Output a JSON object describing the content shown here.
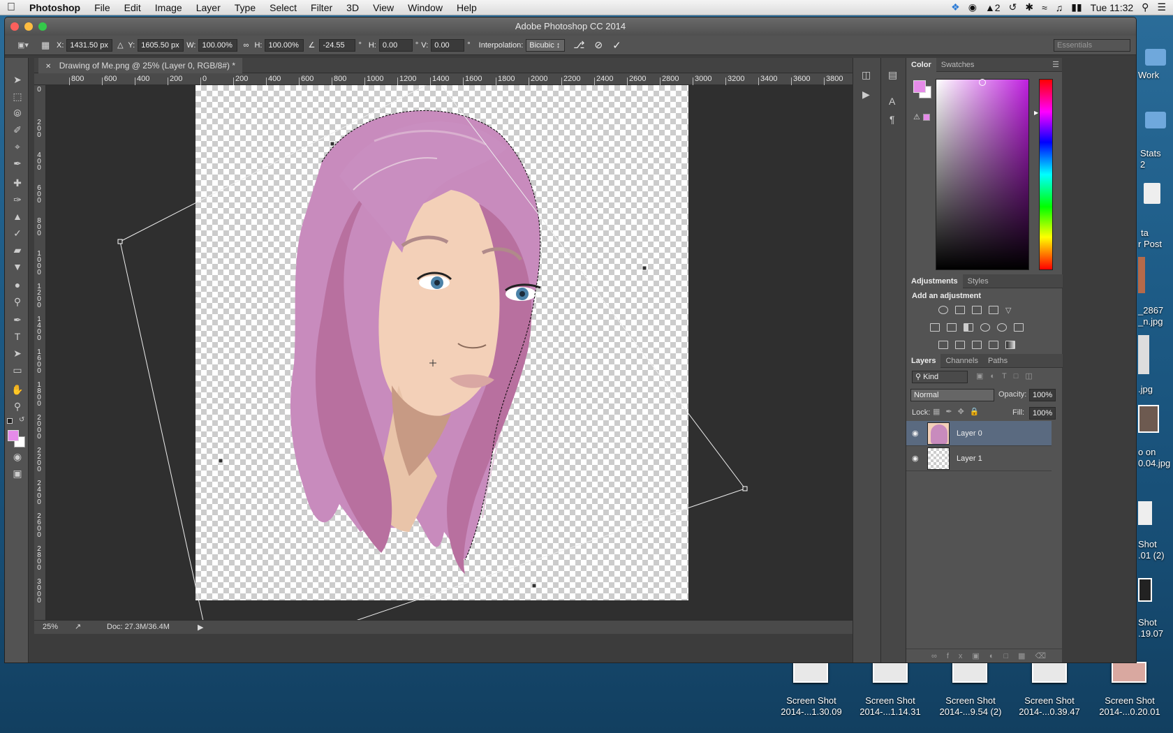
{
  "menubar": {
    "app": "Photoshop",
    "items": [
      "File",
      "Edit",
      "Image",
      "Layer",
      "Type",
      "Select",
      "Filter",
      "3D",
      "View",
      "Window",
      "Help"
    ],
    "status_indicator": "2",
    "clock": "Tue 11:32"
  },
  "window": {
    "title": "Adobe Photoshop CC 2014"
  },
  "options": {
    "x_label": "X:",
    "x": "1431.50 px",
    "y_label": "Y:",
    "y": "1605.50 px",
    "w_label": "W:",
    "w": "100.00%",
    "h_label": "H:",
    "h": "100.00%",
    "angle": "-24.55",
    "angle_unit": "°",
    "hskew_label": "H:",
    "hskew": "0.00",
    "vskew_label": "V:",
    "vskew": "0.00",
    "deg": "°",
    "interp_label": "Interpolation:",
    "interp": "Bicubic",
    "workspace": "Essentials"
  },
  "document": {
    "tab": "Drawing of Me.png @ 25% (Layer 0, RGB/8#) *",
    "zoom": "25%",
    "doc_size": "Doc: 27.3M/36.4M"
  },
  "ruler_h": [
    "800",
    "600",
    "400",
    "200",
    "0",
    "200",
    "400",
    "600",
    "800",
    "1000",
    "1200",
    "1400",
    "1600",
    "1800",
    "2000",
    "2200",
    "2400",
    "2600",
    "2800",
    "3000",
    "3200",
    "3400",
    "3600",
    "3800"
  ],
  "ruler_v": [
    [
      "0"
    ],
    [
      "2",
      "0",
      "0"
    ],
    [
      "4",
      "0",
      "0"
    ],
    [
      "6",
      "0",
      "0"
    ],
    [
      "8",
      "0",
      "0"
    ],
    [
      "1",
      "0",
      "0",
      "0"
    ],
    [
      "1",
      "2",
      "0",
      "0"
    ],
    [
      "1",
      "4",
      "0",
      "0"
    ],
    [
      "1",
      "6",
      "0",
      "0"
    ],
    [
      "1",
      "8",
      "0",
      "0"
    ],
    [
      "2",
      "0",
      "0",
      "0"
    ],
    [
      "2",
      "2",
      "0",
      "0"
    ],
    [
      "2",
      "4",
      "0",
      "0"
    ],
    [
      "2",
      "6",
      "0",
      "0"
    ],
    [
      "2",
      "8",
      "0",
      "0"
    ],
    [
      "3",
      "0",
      "0",
      "0"
    ]
  ],
  "color_panel": {
    "tabs": [
      "Color",
      "Swatches"
    ],
    "foreground": "#e58be8",
    "background": "#ffffff",
    "picker_hue": "#c020e0"
  },
  "adjustments_panel": {
    "tabs": [
      "Adjustments",
      "Styles"
    ],
    "heading": "Add an adjustment"
  },
  "layers_panel": {
    "tabs": [
      "Layers",
      "Channels",
      "Paths"
    ],
    "kind": "Kind",
    "blend": "Normal",
    "opacity_label": "Opacity:",
    "opacity": "100%",
    "lock_label": "Lock:",
    "fill_label": "Fill:",
    "fill": "100%",
    "layers": [
      {
        "name": "Layer 0",
        "selected": true
      },
      {
        "name": "Layer 1",
        "selected": false
      }
    ]
  },
  "desktop": {
    "right_labels": [
      {
        "t": "Work"
      },
      {
        "t": "Stats"
      },
      {
        "t": "2"
      },
      {
        "t": "ta"
      },
      {
        "t": "r Post"
      },
      {
        "t": "_2867"
      },
      {
        "t": "_n.jpg"
      },
      {
        "t": ".jpg"
      },
      {
        "t": "o on"
      },
      {
        "t": "0.04.jpg"
      },
      {
        "t": "Shot"
      },
      {
        "t": ".01 (2)"
      },
      {
        "t": "Shot"
      },
      {
        "t": ".19.07"
      }
    ],
    "files": [
      {
        "l1": "Screen Shot",
        "l2": "2014-...1.30.09"
      },
      {
        "l1": "Screen Shot",
        "l2": "2014-...1.14.31"
      },
      {
        "l1": "Screen Shot",
        "l2": "2014-...9.54 (2)"
      },
      {
        "l1": "Screen Shot",
        "l2": "2014-...0.39.47"
      },
      {
        "l1": "Screen Shot",
        "l2": "2014-...0.20.01"
      }
    ]
  }
}
